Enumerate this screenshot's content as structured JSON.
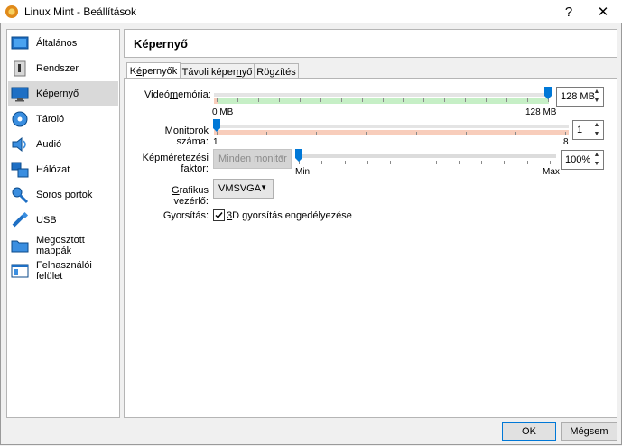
{
  "window": {
    "title": "Linux Mint - Beállítások",
    "help_glyph": "?",
    "close_glyph": "✕"
  },
  "sidebar": {
    "items": [
      {
        "label": "Általános",
        "icon": "general-icon"
      },
      {
        "label": "Rendszer",
        "icon": "system-icon"
      },
      {
        "label": "Képernyő",
        "icon": "display-icon",
        "selected": true
      },
      {
        "label": "Tároló",
        "icon": "storage-icon"
      },
      {
        "label": "Audió",
        "icon": "audio-icon"
      },
      {
        "label": "Hálózat",
        "icon": "network-icon"
      },
      {
        "label": "Soros portok",
        "icon": "serial-ports-icon"
      },
      {
        "label": "USB",
        "icon": "usb-icon"
      },
      {
        "label": "Megosztott mappák",
        "icon": "shared-folders-icon"
      },
      {
        "label": "Felhasználói felület",
        "icon": "user-interface-icon"
      }
    ]
  },
  "page": {
    "title": "Képernyő"
  },
  "tabs": [
    {
      "pre": "K",
      "u": "é",
      "post": "pernyők",
      "active": true
    },
    {
      "pre": "Távoli képer",
      "u": "n",
      "post": "yő",
      "active": false
    },
    {
      "pre": "Rö",
      "u": "g",
      "post": "zítés",
      "active": false
    }
  ],
  "video_memory": {
    "label_pre": "Videó",
    "label_u": "m",
    "label_post": "emória:",
    "value": "128 MB",
    "min_label": "0 MB",
    "max_label": "128 MB",
    "fraction": 1.0
  },
  "monitors": {
    "label_pre": "M",
    "label_u": "o",
    "label_post": "nitorok száma:",
    "value": "1",
    "min_label": "1",
    "max_label": "8",
    "fraction": 0.0
  },
  "scale_factor": {
    "label": "Képméretezési faktor:",
    "combo_value": "Minden monitor",
    "value": "100%",
    "min_label": "Min",
    "max_label": "Max",
    "fraction": 0.0
  },
  "graphics_controller": {
    "label_pre": "",
    "label_u": "G",
    "label_post": "rafikus vezérlő:",
    "value": "VMSVGA"
  },
  "acceleration": {
    "label": "Gyorsítás:",
    "checkbox_pre": "",
    "checkbox_u": "3",
    "checkbox_post": "D gyorsítás engedélyezése",
    "checked": true
  },
  "buttons": {
    "ok": "OK",
    "cancel": "Mégsem"
  },
  "colors": {
    "accent": "#0078d7",
    "green_zone": "#c6efc6",
    "red_zone": "#f8cdbb",
    "selected_bg": "#d9d9d9"
  }
}
